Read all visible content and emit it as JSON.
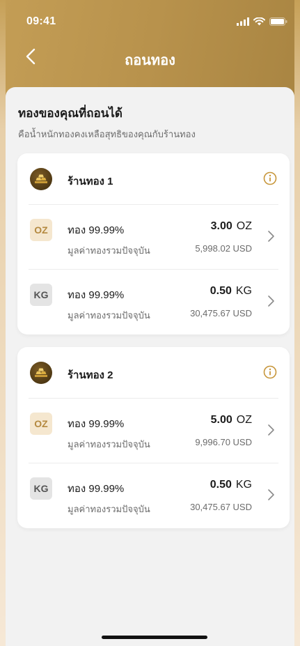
{
  "status": {
    "time": "09:41"
  },
  "nav": {
    "title": "ถอนทอง"
  },
  "page": {
    "title": "ทองของคุณที่ถอนได้",
    "subtitle": "คือน้ำหนักทองคงเหลือสุทธิของคุณกับร้านทอง"
  },
  "stores": [
    {
      "name": "ร้านทอง 1",
      "items": [
        {
          "badge": "OZ",
          "purity": "ทอง 99.99%",
          "amount": "3.00",
          "unit": "OZ",
          "value_label": "มูลค่าทองรวมปัจจุบัน",
          "value": "5,998.02 USD"
        },
        {
          "badge": "KG",
          "purity": "ทอง 99.99%",
          "amount": "0.50",
          "unit": "KG",
          "value_label": "มูลค่าทองรวมปัจจุบัน",
          "value": "30,475.67 USD"
        }
      ]
    },
    {
      "name": "ร้านทอง 2",
      "items": [
        {
          "badge": "OZ",
          "purity": "ทอง 99.99%",
          "amount": "5.00",
          "unit": "OZ",
          "value_label": "มูลค่าทองรวมปัจจุบัน",
          "value": "9,996.70 USD"
        },
        {
          "badge": "KG",
          "purity": "ทอง 99.99%",
          "amount": "0.50",
          "unit": "KG",
          "value_label": "มูลค่าทองรวมปัจจุบัน",
          "value": "30,475.67 USD"
        }
      ]
    }
  ],
  "icons": {
    "back": "chevron-left-icon",
    "info": "info-circle-icon",
    "row": "chevron-right-icon",
    "store": "gold-bar-icon"
  },
  "colors": {
    "header_gold": "#b8924c",
    "accent_gold": "#c7963a",
    "oz_badge_bg": "#f5e7cf",
    "kg_badge_bg": "#e4e4e4"
  }
}
